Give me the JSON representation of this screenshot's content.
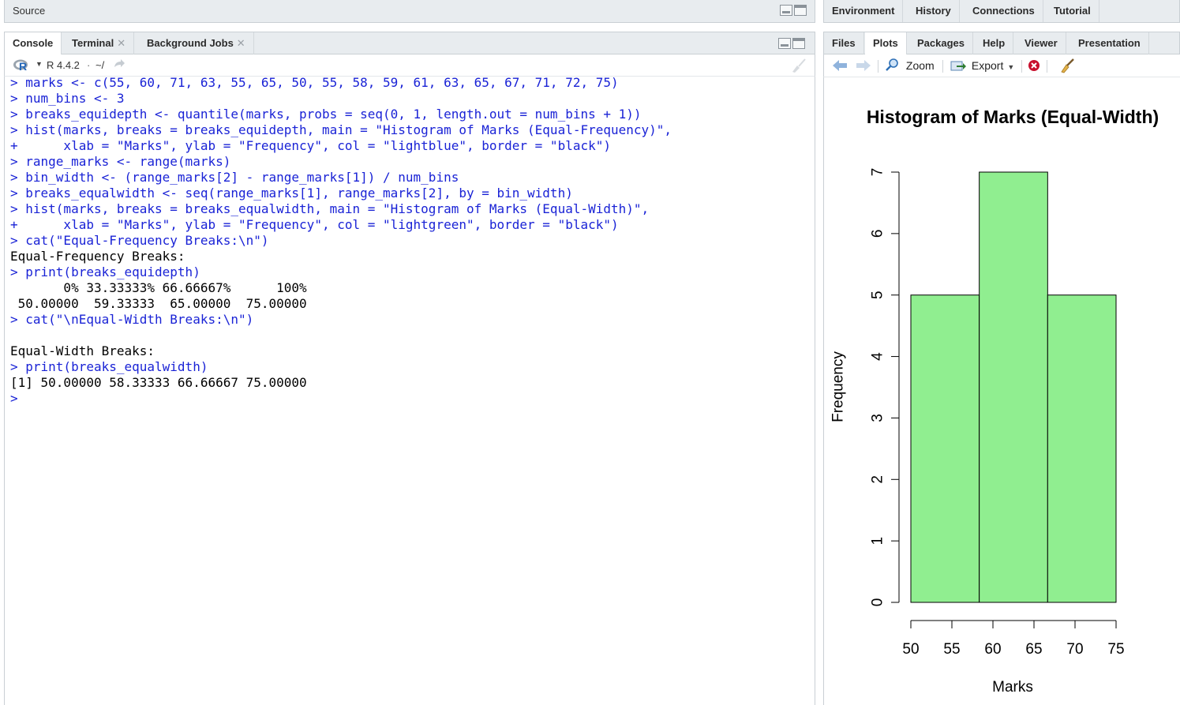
{
  "source_pane": {
    "title": "Source"
  },
  "console_pane": {
    "tabs": [
      {
        "label": "Console",
        "closable": false,
        "active": true
      },
      {
        "label": "Terminal",
        "closable": true,
        "active": false
      },
      {
        "label": "Background Jobs",
        "closable": true,
        "active": false
      }
    ],
    "r_version": "R 4.4.2",
    "working_dir": "~/",
    "lines": [
      {
        "type": "cmd",
        "text": "> marks <- c(55, 60, 71, 63, 55, 65, 50, 55, 58, 59, 61, 63, 65, 67, 71, 72, 75)"
      },
      {
        "type": "cmd",
        "text": "> num_bins <- 3"
      },
      {
        "type": "cmd",
        "text": "> breaks_equidepth <- quantile(marks, probs = seq(0, 1, length.out = num_bins + 1))"
      },
      {
        "type": "cmd",
        "text": "> hist(marks, breaks = breaks_equidepth, main = \"Histogram of Marks (Equal-Frequency)\","
      },
      {
        "type": "cmd",
        "text": "+      xlab = \"Marks\", ylab = \"Frequency\", col = \"lightblue\", border = \"black\")"
      },
      {
        "type": "cmd",
        "text": "> range_marks <- range(marks)"
      },
      {
        "type": "cmd",
        "text": "> bin_width <- (range_marks[2] - range_marks[1]) / num_bins"
      },
      {
        "type": "cmd",
        "text": "> breaks_equalwidth <- seq(range_marks[1], range_marks[2], by = bin_width)"
      },
      {
        "type": "cmd",
        "text": "> hist(marks, breaks = breaks_equalwidth, main = \"Histogram of Marks (Equal-Width)\","
      },
      {
        "type": "cmd",
        "text": "+      xlab = \"Marks\", ylab = \"Frequency\", col = \"lightgreen\", border = \"black\")"
      },
      {
        "type": "cmd",
        "text": "> cat(\"Equal-Frequency Breaks:\\n\")"
      },
      {
        "type": "out",
        "text": "Equal-Frequency Breaks:"
      },
      {
        "type": "cmd",
        "text": "> print(breaks_equidepth)"
      },
      {
        "type": "out",
        "text": "       0% 33.33333% 66.66667%      100%"
      },
      {
        "type": "out",
        "text": " 50.00000  59.33333  65.00000  75.00000"
      },
      {
        "type": "cmd",
        "text": "> cat(\"\\nEqual-Width Breaks:\\n\")"
      },
      {
        "type": "out",
        "text": ""
      },
      {
        "type": "out",
        "text": "Equal-Width Breaks:"
      },
      {
        "type": "cmd",
        "text": "> print(breaks_equalwidth)"
      },
      {
        "type": "out",
        "text": "[1] 50.00000 58.33333 66.66667 75.00000"
      },
      {
        "type": "cmd",
        "text": ">"
      }
    ]
  },
  "env_pane": {
    "tabs": [
      {
        "label": "Environment"
      },
      {
        "label": "History"
      },
      {
        "label": "Connections"
      },
      {
        "label": "Tutorial"
      }
    ]
  },
  "files_pane": {
    "tabs": [
      {
        "label": "Files",
        "active": false
      },
      {
        "label": "Plots",
        "active": true
      },
      {
        "label": "Packages",
        "active": false
      },
      {
        "label": "Help",
        "active": false
      },
      {
        "label": "Viewer",
        "active": false
      },
      {
        "label": "Presentation",
        "active": false
      }
    ],
    "toolbar": {
      "zoom_label": "Zoom",
      "export_label": "Export",
      "icons": [
        "back-arrow-icon",
        "forward-arrow-icon",
        "zoom-icon",
        "export-icon",
        "remove-plot-icon",
        "broom-icon"
      ]
    }
  },
  "colors": {
    "command_text": "#1a23d6",
    "output_text": "#000000",
    "bar_fill": "#90ee90",
    "bar_border": "#000000"
  },
  "chart_data": {
    "type": "bar",
    "title": "Histogram of Marks (Equal-Width)",
    "xlabel": "Marks",
    "ylabel": "Frequency",
    "bins": [
      [
        50,
        58.33333
      ],
      [
        58.33333,
        66.66667
      ],
      [
        66.66667,
        75
      ]
    ],
    "values": [
      5,
      7,
      5
    ],
    "xlim": [
      50,
      75
    ],
    "ylim": [
      0,
      7
    ],
    "x_ticks": [
      50,
      55,
      60,
      65,
      70,
      75
    ],
    "y_ticks": [
      0,
      1,
      2,
      3,
      4,
      5,
      6,
      7
    ],
    "grid": false
  }
}
